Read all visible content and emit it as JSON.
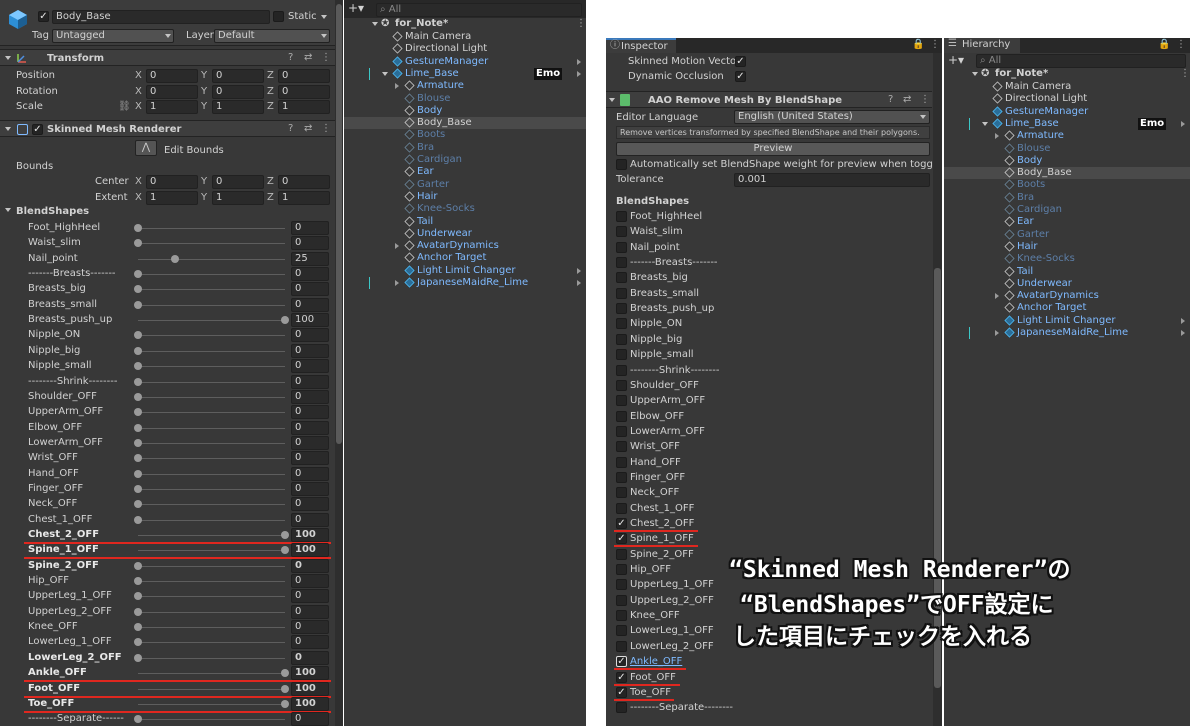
{
  "left_inspector": {
    "object_name": "Body_Base",
    "static_label": "Static",
    "tag_label": "Tag",
    "tag_value": "Untagged",
    "layer_label": "Layer",
    "layer_value": "Default",
    "transform": {
      "title": "Transform",
      "rows": [
        {
          "label": "Position",
          "x": "0",
          "y": "0",
          "z": "0"
        },
        {
          "label": "Rotation",
          "x": "0",
          "y": "0",
          "z": "0"
        },
        {
          "label": "Scale",
          "x": "1",
          "y": "1",
          "z": "1"
        }
      ]
    },
    "smr": {
      "title": "Skinned Mesh Renderer",
      "edit_bounds": "Edit Bounds",
      "bounds_label": "Bounds",
      "center_label": "Center",
      "extent_label": "Extent",
      "center": {
        "x": "0",
        "y": "0",
        "z": "0"
      },
      "extent": {
        "x": "1",
        "y": "1",
        "z": "1"
      }
    },
    "axis": {
      "x": "X",
      "y": "Y",
      "z": "Z"
    },
    "blendshapes_label": "BlendShapes",
    "blendshapes": [
      {
        "name": "Foot_HighHeel",
        "value": 0,
        "bold": false,
        "red": false
      },
      {
        "name": "Waist_slim",
        "value": 0,
        "bold": false,
        "red": false
      },
      {
        "name": "Nail_point",
        "value": 25,
        "bold": false,
        "red": false
      },
      {
        "name": "-------Breasts-------",
        "value": 0,
        "bold": false,
        "red": false
      },
      {
        "name": "Breasts_big",
        "value": 0,
        "bold": false,
        "red": false
      },
      {
        "name": "Breasts_small",
        "value": 0,
        "bold": false,
        "red": false
      },
      {
        "name": "Breasts_push_up",
        "value": 100,
        "bold": false,
        "red": false
      },
      {
        "name": "Nipple_ON",
        "value": 0,
        "bold": false,
        "red": false
      },
      {
        "name": "Nipple_big",
        "value": 0,
        "bold": false,
        "red": false
      },
      {
        "name": "Nipple_small",
        "value": 0,
        "bold": false,
        "red": false
      },
      {
        "name": "--------Shrink--------",
        "value": 0,
        "bold": false,
        "red": false
      },
      {
        "name": "Shoulder_OFF",
        "value": 0,
        "bold": false,
        "red": false
      },
      {
        "name": "UpperArm_OFF",
        "value": 0,
        "bold": false,
        "red": false
      },
      {
        "name": "Elbow_OFF",
        "value": 0,
        "bold": false,
        "red": false
      },
      {
        "name": "LowerArm_OFF",
        "value": 0,
        "bold": false,
        "red": false
      },
      {
        "name": "Wrist_OFF",
        "value": 0,
        "bold": false,
        "red": false
      },
      {
        "name": "Hand_OFF",
        "value": 0,
        "bold": false,
        "red": false
      },
      {
        "name": "Finger_OFF",
        "value": 0,
        "bold": false,
        "red": false
      },
      {
        "name": "Neck_OFF",
        "value": 0,
        "bold": false,
        "red": false
      },
      {
        "name": "Chest_1_OFF",
        "value": 0,
        "bold": false,
        "red": false
      },
      {
        "name": "Chest_2_OFF",
        "value": 100,
        "bold": true,
        "red": true
      },
      {
        "name": "Spine_1_OFF",
        "value": 100,
        "bold": true,
        "red": true
      },
      {
        "name": "Spine_2_OFF",
        "value": 0,
        "bold": true,
        "red": false
      },
      {
        "name": "Hip_OFF",
        "value": 0,
        "bold": false,
        "red": false
      },
      {
        "name": "UpperLeg_1_OFF",
        "value": 0,
        "bold": false,
        "red": false
      },
      {
        "name": "UpperLeg_2_OFF",
        "value": 0,
        "bold": false,
        "red": false
      },
      {
        "name": "Knee_OFF",
        "value": 0,
        "bold": false,
        "red": false
      },
      {
        "name": "LowerLeg_1_OFF",
        "value": 0,
        "bold": false,
        "red": false
      },
      {
        "name": "LowerLeg_2_OFF",
        "value": 0,
        "bold": true,
        "red": false
      },
      {
        "name": "Ankle_OFF",
        "value": 100,
        "bold": true,
        "red": true
      },
      {
        "name": "Foot_OFF",
        "value": 100,
        "bold": true,
        "red": true
      },
      {
        "name": "Toe_OFF",
        "value": 100,
        "bold": true,
        "red": true
      },
      {
        "name": "--------Separate------",
        "value": 0,
        "bold": false,
        "red": false
      }
    ]
  },
  "left_hierarchy": {
    "search_placeholder": "All",
    "scene": "for_Note*",
    "items": [
      {
        "label": "Main Camera",
        "depth": 1,
        "style": "normal",
        "icon": "cube",
        "arrow": false,
        "expanded": false,
        "selected": false,
        "badge": ""
      },
      {
        "label": "Directional Light",
        "depth": 1,
        "style": "normal",
        "icon": "cube",
        "arrow": false,
        "expanded": false,
        "selected": false,
        "badge": ""
      },
      {
        "label": "GestureManager",
        "depth": 1,
        "style": "blue",
        "icon": "prefab",
        "arrow": false,
        "expanded": false,
        "selected": false,
        "badge": ""
      },
      {
        "label": "Lime_Base",
        "depth": 1,
        "style": "blue",
        "icon": "prefab",
        "arrow": true,
        "expanded": true,
        "selected": false,
        "badge": "Emo"
      },
      {
        "label": "Armature",
        "depth": 2,
        "style": "blue",
        "icon": "cube",
        "arrow": true,
        "expanded": false,
        "selected": false,
        "badge": ""
      },
      {
        "label": "Blouse",
        "depth": 2,
        "style": "dim",
        "icon": "cube",
        "arrow": false,
        "expanded": false,
        "selected": false,
        "badge": ""
      },
      {
        "label": "Body",
        "depth": 2,
        "style": "blue",
        "icon": "cube",
        "arrow": false,
        "expanded": false,
        "selected": false,
        "badge": ""
      },
      {
        "label": "Body_Base",
        "depth": 2,
        "style": "normal",
        "icon": "cube",
        "arrow": false,
        "expanded": false,
        "selected": true,
        "badge": ""
      },
      {
        "label": "Boots",
        "depth": 2,
        "style": "dim",
        "icon": "cube",
        "arrow": false,
        "expanded": false,
        "selected": false,
        "badge": ""
      },
      {
        "label": "Bra",
        "depth": 2,
        "style": "dim",
        "icon": "cube",
        "arrow": false,
        "expanded": false,
        "selected": false,
        "badge": ""
      },
      {
        "label": "Cardigan",
        "depth": 2,
        "style": "dim",
        "icon": "cube",
        "arrow": false,
        "expanded": false,
        "selected": false,
        "badge": ""
      },
      {
        "label": "Ear",
        "depth": 2,
        "style": "blue",
        "icon": "cube",
        "arrow": false,
        "expanded": false,
        "selected": false,
        "badge": ""
      },
      {
        "label": "Garter",
        "depth": 2,
        "style": "dim",
        "icon": "cube",
        "arrow": false,
        "expanded": false,
        "selected": false,
        "badge": ""
      },
      {
        "label": "Hair",
        "depth": 2,
        "style": "blue",
        "icon": "cube",
        "arrow": false,
        "expanded": false,
        "selected": false,
        "badge": ""
      },
      {
        "label": "Knee-Socks",
        "depth": 2,
        "style": "dim",
        "icon": "cube",
        "arrow": false,
        "expanded": false,
        "selected": false,
        "badge": ""
      },
      {
        "label": "Tail",
        "depth": 2,
        "style": "blue",
        "icon": "cube",
        "arrow": false,
        "expanded": false,
        "selected": false,
        "badge": ""
      },
      {
        "label": "Underwear",
        "depth": 2,
        "style": "blue",
        "icon": "cube",
        "arrow": false,
        "expanded": false,
        "selected": false,
        "badge": ""
      },
      {
        "label": "AvatarDynamics",
        "depth": 2,
        "style": "blue",
        "icon": "cube",
        "arrow": true,
        "expanded": false,
        "selected": false,
        "badge": ""
      },
      {
        "label": "Anchor Target",
        "depth": 2,
        "style": "blue",
        "icon": "cube",
        "arrow": false,
        "expanded": false,
        "selected": false,
        "badge": ""
      },
      {
        "label": "Light Limit Changer",
        "depth": 2,
        "style": "blue",
        "icon": "prefab",
        "arrow": false,
        "expanded": false,
        "selected": false,
        "badge": ""
      },
      {
        "label": "JapaneseMaidRe_Lime",
        "depth": 2,
        "style": "blue",
        "icon": "prefab",
        "arrow": true,
        "expanded": false,
        "selected": false,
        "badge": ""
      }
    ]
  },
  "right_inspector": {
    "tab": "Inspector",
    "skinned_motion_vectors": "Skinned Motion Vectors",
    "dynamic_occlusion": "Dynamic Occlusion",
    "component_title": "AAO Remove Mesh By BlendShape",
    "editor_language_label": "Editor Language",
    "editor_language_value": "English (United States)",
    "description": "Remove vertices transformed by specified BlendShape and their polygons.",
    "preview_label": "Preview",
    "auto_set_label": "Automatically set BlendShape weight for preview when toggled",
    "tolerance_label": "Tolerance",
    "tolerance_value": "0.001",
    "blendshapes_label": "BlendShapes",
    "items": [
      {
        "name": "Foot_HighHeel",
        "checked": false,
        "red": false,
        "link": false
      },
      {
        "name": "Waist_slim",
        "checked": false,
        "red": false,
        "link": false
      },
      {
        "name": "Nail_point",
        "checked": false,
        "red": false,
        "link": false
      },
      {
        "name": "-------Breasts-------",
        "checked": false,
        "red": false,
        "link": false
      },
      {
        "name": "Breasts_big",
        "checked": false,
        "red": false,
        "link": false
      },
      {
        "name": "Breasts_small",
        "checked": false,
        "red": false,
        "link": false
      },
      {
        "name": "Breasts_push_up",
        "checked": false,
        "red": false,
        "link": false
      },
      {
        "name": "Nipple_ON",
        "checked": false,
        "red": false,
        "link": false
      },
      {
        "name": "Nipple_big",
        "checked": false,
        "red": false,
        "link": false
      },
      {
        "name": "Nipple_small",
        "checked": false,
        "red": false,
        "link": false
      },
      {
        "name": "--------Shrink--------",
        "checked": false,
        "red": false,
        "link": false
      },
      {
        "name": "Shoulder_OFF",
        "checked": false,
        "red": false,
        "link": false
      },
      {
        "name": "UpperArm_OFF",
        "checked": false,
        "red": false,
        "link": false
      },
      {
        "name": "Elbow_OFF",
        "checked": false,
        "red": false,
        "link": false
      },
      {
        "name": "LowerArm_OFF",
        "checked": false,
        "red": false,
        "link": false
      },
      {
        "name": "Wrist_OFF",
        "checked": false,
        "red": false,
        "link": false
      },
      {
        "name": "Hand_OFF",
        "checked": false,
        "red": false,
        "link": false
      },
      {
        "name": "Finger_OFF",
        "checked": false,
        "red": false,
        "link": false
      },
      {
        "name": "Neck_OFF",
        "checked": false,
        "red": false,
        "link": false
      },
      {
        "name": "Chest_1_OFF",
        "checked": false,
        "red": false,
        "link": false
      },
      {
        "name": "Chest_2_OFF",
        "checked": true,
        "red": true,
        "link": false
      },
      {
        "name": "Spine_1_OFF",
        "checked": true,
        "red": true,
        "link": false
      },
      {
        "name": "Spine_2_OFF",
        "checked": false,
        "red": false,
        "link": false
      },
      {
        "name": "Hip_OFF",
        "checked": false,
        "red": false,
        "link": false
      },
      {
        "name": "UpperLeg_1_OFF",
        "checked": false,
        "red": false,
        "link": false
      },
      {
        "name": "UpperLeg_2_OFF",
        "checked": false,
        "red": false,
        "link": false
      },
      {
        "name": "Knee_OFF",
        "checked": false,
        "red": false,
        "link": false
      },
      {
        "name": "LowerLeg_1_OFF",
        "checked": false,
        "red": false,
        "link": false
      },
      {
        "name": "LowerLeg_2_OFF",
        "checked": false,
        "red": false,
        "link": false
      },
      {
        "name": "Ankle_OFF",
        "checked": true,
        "red": true,
        "link": true
      },
      {
        "name": "Foot_OFF",
        "checked": true,
        "red": true,
        "link": false
      },
      {
        "name": "Toe_OFF",
        "checked": true,
        "red": true,
        "link": false
      },
      {
        "name": "--------Separate--------",
        "checked": false,
        "red": false,
        "link": false
      }
    ]
  },
  "right_hierarchy": {
    "tab": "Hierarchy",
    "search_placeholder": "All",
    "scene": "for_Note*"
  },
  "annotation": {
    "line1": "“Skinned Mesh Renderer”の",
    "line2": "“BlendShapes”でOFF設定に",
    "line3": "した項目にチェックを入れる"
  },
  "colors": {
    "panel_bg": "#383838",
    "accent_blue": "#7fbaff",
    "highlight_red": "#e0271f"
  }
}
